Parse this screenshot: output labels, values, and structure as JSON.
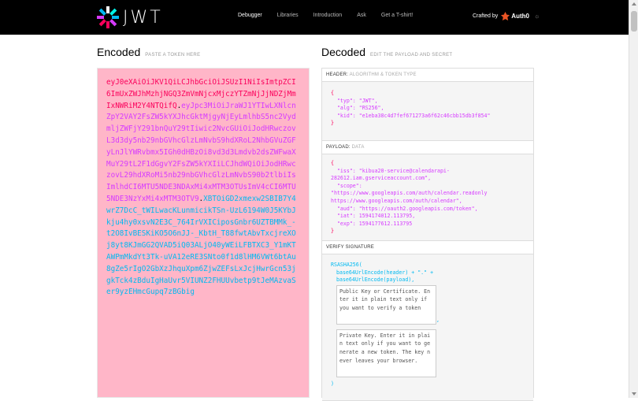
{
  "header": {
    "logo_text": "JWT",
    "nav": [
      "Debugger",
      "Libraries",
      "Introduction",
      "Ask",
      "Get a T-shirt!"
    ],
    "crafted_by": "Crafted by",
    "brand": "Auth0"
  },
  "encoded": {
    "title": "Encoded",
    "subtitle": "PASTE A TOKEN HERE",
    "token_header": "eyJ0eXAiOiJKV1QiLCJhbGciOiJSUzI1NiIsImtpZCI6ImUxZWJhMzhjNGQ3ZmVmNjcxMjczYTZmNjJjNDZjMmIxNWRiM2Y4NTQifQ",
    "token_payload": "eyJpc3MiOiJraWJ1YTIwLXNlcnZpY2VAY2FsZW5kYXJhcGktMjgyNjEyLmlhbS5nc2VydmljZWFjY291bnQuY29tIiwic2NvcGUiOiJodHRwczovL3d3dy5nb29nbGVhcGlzLmNvbS9hdXRoL2NhbGVuZGFyLnJlYWRvbmx5IGh0dHBzOi8vd3d3Lmdvb2dsZWFwaXMuY29tL2F1dGgvY2FsZW5kYXIiLCJhdWQiOiJodHRwczovL29hdXRoMi5nb29nbGVhcGlzLmNvbS90b2tlbiIsImlhdCI6MTU5NDE3NDAxMi4xMTM3OTUsImV4cCI6MTU5NDE3NzYxMi4xMTM3OTV9",
    "token_signature": "XBTOiGD2xmexw2SBIB7Y4wrZ7DcC_tWILwacKLunmicikTSn-UzL6194W0J5KYbJkju4hy0xsvN2E3C_764IrVXICiposGnbr6UZTBMMk_-t2O8IvBESKiKO5O6nJJ-_KbtH_T88fwtAbvTxcjreXOj8yt8KJmGG2QVAD5iQ03ALjO40yWEiLFBTXC3_Y1mKTAWPmMkdYt3Tk-uVA12eRE3SNto0f1d8lHM6VWt6btAu8gZe5rIgO2GbXzJhquXpm6ZjwZEFsLxJcjHwrGcn53jgkTck4zBduIgHaUvr5VIUNZ2FHUUvbetp9tJeMAzvaSer9yzEHmcGupq7zBGbig"
  },
  "decoded": {
    "title": "Decoded",
    "subtitle": "EDIT THE PAYLOAD AND SECRET",
    "header_label": "HEADER:",
    "header_sub": "ALGORITHM & TOKEN TYPE",
    "header_json": [
      {
        "k": "typ",
        "v": "JWT"
      },
      {
        "k": "alg",
        "v": "RS256"
      },
      {
        "k": "kid",
        "v": "e1eba38c4d7fef671273a6f62c46cbb15db3f854"
      }
    ],
    "payload_label": "PAYLOAD:",
    "payload_sub": "DATA",
    "payload_lines": [
      "{",
      "  \"iss\": \"kibua20-service@calendarapi-",
      "282612.iam.gserviceaccount.com\",",
      "  \"scope\":",
      "\"https://www.googleapis.com/auth/calendar.readonly",
      "https://www.googleapis.com/auth/calendar\",",
      "  \"aud\": \"https://oauth2.googleapis.com/token\",",
      "  \"iat\": 1594174012.113795,",
      "  \"exp\": 1594177612.113795",
      "}"
    ],
    "signature_label": "VERIFY SIGNATURE",
    "sig_fn": "RSASHA256(",
    "sig_line1": "base64UrlEncode(header) + \".\" +",
    "sig_line2": "base64UrlEncode(payload),",
    "public_key_placeholder": "Public Key or Certificate. Enter it in plain text only if you want to verify a token",
    "private_key_placeholder": "Private Key. Enter it in plain text only if you want to generate a new token. The key never leaves your browser.",
    "sig_close": ")"
  },
  "colors": {
    "header_part": "#fb015b",
    "payload_part": "#d63aff",
    "signature_part": "#00b9f1",
    "encoded_bg": "#ffb6c8"
  }
}
